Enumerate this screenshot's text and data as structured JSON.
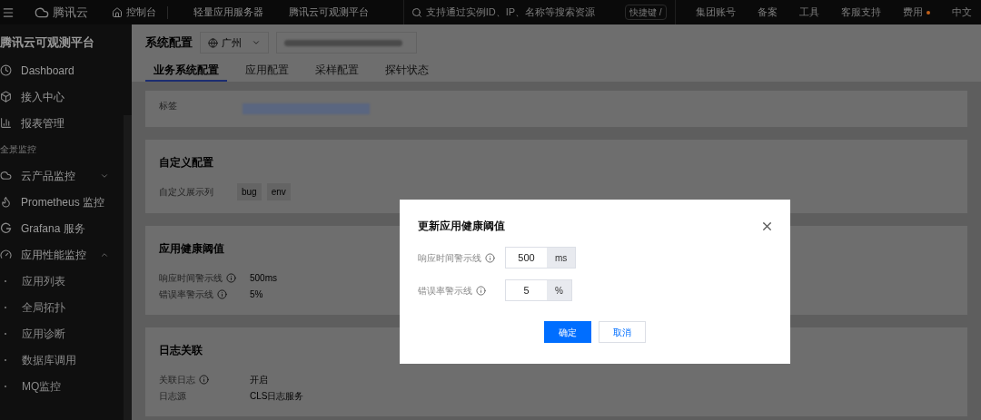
{
  "top_bar": {
    "brand": "腾讯云",
    "nav": [
      {
        "label": "控制台",
        "kind": "home"
      },
      {
        "label": "轻量应用服务器",
        "kind": "link"
      },
      {
        "label": "腾讯云可观测平台",
        "kind": "link"
      }
    ],
    "search": {
      "placeholder": "支持通过实例ID、IP、名称等搜索资源"
    },
    "shortcut": "快捷键 /",
    "links": [
      {
        "label": "集团账号",
        "dot": false
      },
      {
        "label": "备案",
        "dot": false
      },
      {
        "label": "工具",
        "dot": false
      },
      {
        "label": "客服支持",
        "dot": false
      },
      {
        "label": "费用",
        "dot": true
      },
      {
        "label": "中文",
        "dot": false
      }
    ]
  },
  "sidebar": {
    "title": "腾讯云可观测平台",
    "items": [
      {
        "kind": "item",
        "label": "Dashboard"
      },
      {
        "kind": "item",
        "label": "接入中心"
      },
      {
        "kind": "item",
        "label": "报表管理"
      },
      {
        "kind": "section",
        "label": "全景监控"
      },
      {
        "kind": "item",
        "label": "云产品监控",
        "expanded": false
      },
      {
        "kind": "item",
        "label": "Prometheus 监控"
      },
      {
        "kind": "item",
        "label": "Grafana 服务"
      },
      {
        "kind": "item",
        "label": "应用性能监控",
        "expanded": true,
        "children": [
          {
            "label": "应用列表"
          },
          {
            "label": "全局拓扑"
          },
          {
            "label": "应用诊断"
          },
          {
            "label": "数据库调用"
          },
          {
            "label": "MQ监控"
          }
        ]
      }
    ]
  },
  "page": {
    "title": "系统配置",
    "region": "广州",
    "tabs": [
      {
        "label": "业务系统配置",
        "selected": true
      },
      {
        "label": "应用配置",
        "selected": false
      },
      {
        "label": "采样配置",
        "selected": false
      },
      {
        "label": "探针状态",
        "selected": false
      }
    ],
    "tag_label": "标签",
    "sections": [
      {
        "kind": "tags",
        "title": "自定义配置",
        "label": "自定义展示列",
        "tags": [
          "bug",
          "env"
        ]
      },
      {
        "kind": "fields",
        "title": "应用健康阈值",
        "fields": [
          {
            "label": "响应时间警示线",
            "info": true,
            "value": "500ms"
          },
          {
            "label": "错误率警示线",
            "info": true,
            "value": "5%"
          }
        ]
      },
      {
        "kind": "fields",
        "title": "日志关联",
        "fields": [
          {
            "label": "关联日志",
            "info": true,
            "value": "开启"
          },
          {
            "label": "日志源",
            "info": false,
            "value": "CLS日志服务"
          }
        ]
      }
    ]
  },
  "dialog": {
    "title": "更新应用健康阈值",
    "fields": [
      {
        "label": "响应时间警示线",
        "value": "500",
        "unit": "ms"
      },
      {
        "label": "错误率警示线",
        "value": "5",
        "unit": "%"
      }
    ],
    "buttons": [
      {
        "label": "确定",
        "primary": true
      },
      {
        "label": "取消",
        "primary": false
      }
    ]
  }
}
